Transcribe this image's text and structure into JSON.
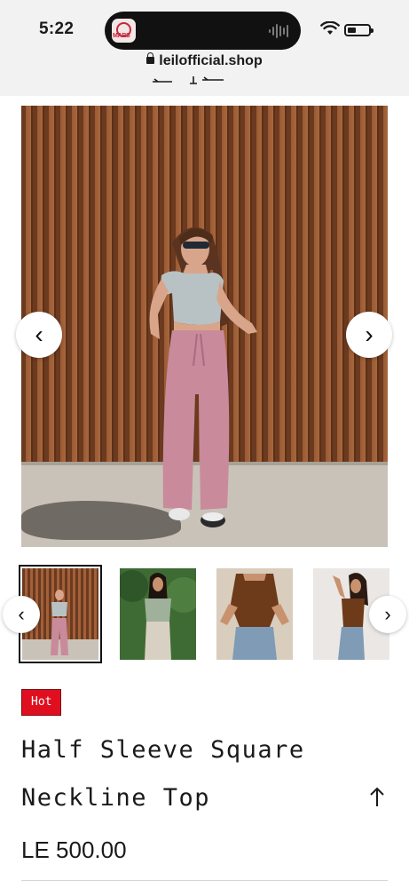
{
  "status_bar": {
    "time": "5:22",
    "island_art_text": "MARS"
  },
  "browser": {
    "url": "leilofficial.shop"
  },
  "product": {
    "badge": "Hot",
    "title_line1": "Half Sleeve Square",
    "title_line2": "Neckline Top",
    "price": "LE 500.00",
    "badge_color": "#e00f1f"
  },
  "gallery": {
    "prev_glyph": "‹",
    "next_glyph": "›",
    "thumbnails": [
      {
        "name": "thumb-1",
        "active": true
      },
      {
        "name": "thumb-2",
        "active": false
      },
      {
        "name": "thumb-3",
        "active": false
      },
      {
        "name": "thumb-4",
        "active": false
      }
    ]
  }
}
